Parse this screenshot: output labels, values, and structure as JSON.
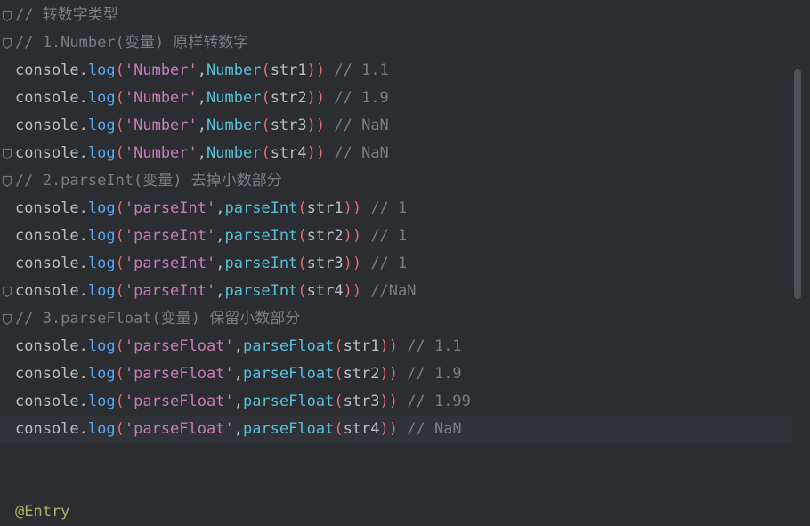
{
  "editor": {
    "lines": [
      {
        "type": "comment",
        "fold": true,
        "text": "// 转数字类型"
      },
      {
        "type": "comment",
        "fold": true,
        "text": "// 1.Number(变量) 原样转数字"
      },
      {
        "type": "call",
        "obj": "console",
        "method": "log",
        "label": "'Number'",
        "fn": "Number",
        "arg": "str1",
        "comment": "// 1.1"
      },
      {
        "type": "call",
        "obj": "console",
        "method": "log",
        "label": "'Number'",
        "fn": "Number",
        "arg": "str2",
        "comment": "// 1.9"
      },
      {
        "type": "call",
        "obj": "console",
        "method": "log",
        "label": "'Number'",
        "fn": "Number",
        "arg": "str3",
        "comment": "// NaN"
      },
      {
        "type": "call",
        "fold": true,
        "obj": "console",
        "method": "log",
        "label": "'Number'",
        "fn": "Number",
        "arg": "str4",
        "comment": "// NaN"
      },
      {
        "type": "comment",
        "fold": true,
        "text": "// 2.parseInt(变量) 去掉小数部分"
      },
      {
        "type": "call",
        "obj": "console",
        "method": "log",
        "label": "'parseInt'",
        "fn": "parseInt",
        "arg": "str1",
        "comment": "// 1"
      },
      {
        "type": "call",
        "obj": "console",
        "method": "log",
        "label": "'parseInt'",
        "fn": "parseInt",
        "arg": "str2",
        "comment": "// 1"
      },
      {
        "type": "call",
        "obj": "console",
        "method": "log",
        "label": "'parseInt'",
        "fn": "parseInt",
        "arg": "str3",
        "comment": "// 1"
      },
      {
        "type": "call",
        "fold": true,
        "obj": "console",
        "method": "log",
        "label": "'parseInt'",
        "fn": "parseInt",
        "arg": "str4",
        "comment": "//NaN"
      },
      {
        "type": "comment",
        "fold": true,
        "text": "// 3.parseFloat(变量) 保留小数部分"
      },
      {
        "type": "call",
        "obj": "console",
        "method": "log",
        "label": "'parseFloat'",
        "fn": "parseFloat",
        "arg": "str1",
        "comment": "// 1.1"
      },
      {
        "type": "call",
        "obj": "console",
        "method": "log",
        "label": "'parseFloat'",
        "fn": "parseFloat",
        "arg": "str2",
        "comment": "// 1.9"
      },
      {
        "type": "call",
        "obj": "console",
        "method": "log",
        "label": "'parseFloat'",
        "fn": "parseFloat",
        "arg": "str3",
        "comment": "// 1.99"
      },
      {
        "type": "call",
        "current": true,
        "obj": "console",
        "method": "log",
        "label": "'parseFloat'",
        "fn": "parseFloat",
        "arg": "str4",
        "comment": "// NaN"
      },
      {
        "type": "blank"
      },
      {
        "type": "blank"
      },
      {
        "type": "annotation",
        "text": "@Entry"
      }
    ]
  },
  "colors": {
    "background": "#2b2d30",
    "current_line": "#303237",
    "comment": "#7a7e85",
    "plain": "#bcbec4",
    "method": "#56a8f5",
    "string": "#c77dbb",
    "function": "#57c0d8",
    "paren": "#e06c75",
    "annotation": "#b3ae60"
  },
  "icons": {
    "fold_marker": "fold-marker-icon"
  }
}
